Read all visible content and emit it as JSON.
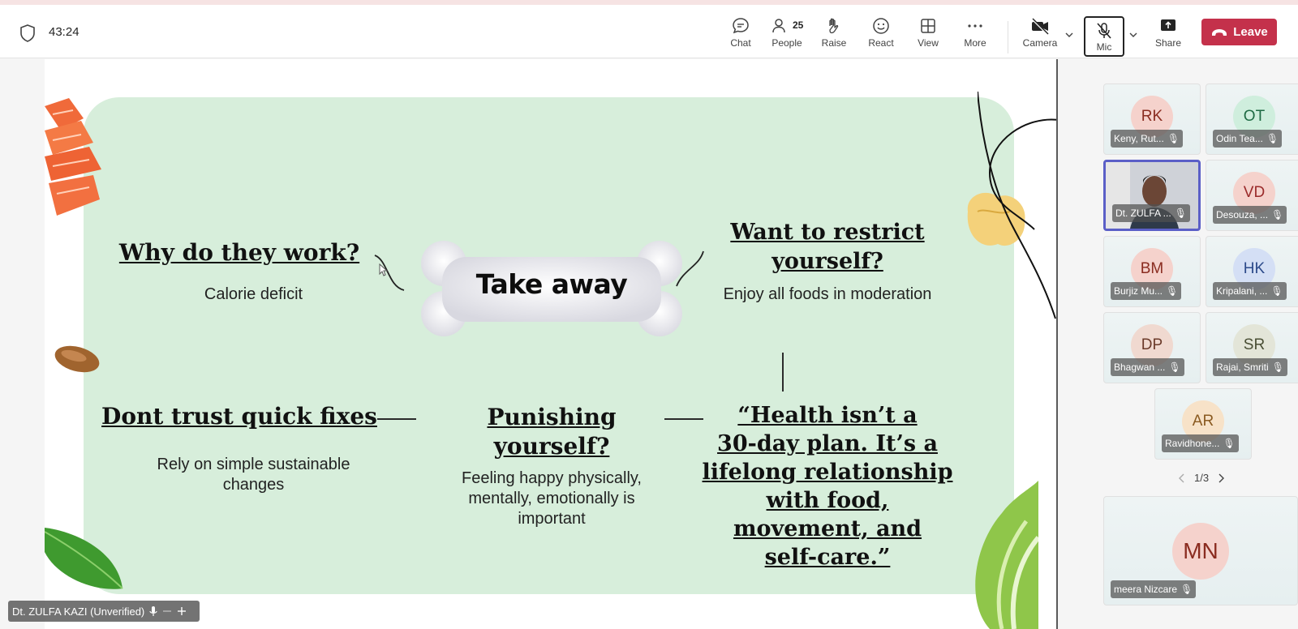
{
  "meeting": {
    "timer": "43:24"
  },
  "toolbar": {
    "chat": "Chat",
    "people": "People",
    "people_count": "25",
    "raise": "Raise",
    "react": "React",
    "view": "View",
    "more": "More",
    "camera": "Camera",
    "mic": "Mic",
    "share": "Share",
    "leave": "Leave"
  },
  "slide": {
    "center_label": "Take away",
    "why_title": "Why do they work?",
    "why_text": "Calorie deficit",
    "restrict_title_1": "Want to restrict",
    "restrict_title_2": "yourself?",
    "restrict_text": "Enjoy all foods in moderation",
    "fixes_title": "Dont trust quick fixes",
    "fixes_text_1": "Rely on simple sustainable",
    "fixes_text_2": "changes",
    "punish_title_1": "Punishing",
    "punish_title_2": "yourself?",
    "punish_text_1": "Feeling happy physically,",
    "punish_text_2": "mentally, emotionally is",
    "punish_text_3": "important",
    "quote_1": "“Health isn’t a",
    "quote_2": "30-day plan. It’s a",
    "quote_3": "lifelong relationship",
    "quote_4": "with food,",
    "quote_5": "movement, and",
    "quote_6": "self-care.”"
  },
  "presenter": {
    "label": "Dt. ZULFA KAZI (Unverified)"
  },
  "participants": [
    {
      "initials": "RK",
      "name": "Keny, Rut...",
      "bg": "#f5d2cc",
      "fg": "#8a2c20"
    },
    {
      "initials": "OT",
      "name": "Odin Tea...",
      "bg": "#cfeedd",
      "fg": "#1f6b44"
    },
    {
      "initials": "",
      "name": "Dt. ZULFA ...",
      "bg": "#4a4a52",
      "fg": "#ffffff"
    },
    {
      "initials": "VD",
      "name": "Desouza, ...",
      "bg": "#f5d2cc",
      "fg": "#9b2b2b"
    },
    {
      "initials": "BM",
      "name": "Burjiz Mu...",
      "bg": "#f5d2cc",
      "fg": "#8a2c20"
    },
    {
      "initials": "HK",
      "name": "Kripalani, ...",
      "bg": "#d4dff5",
      "fg": "#2c4a8a"
    },
    {
      "initials": "DP",
      "name": "Bhagwan ...",
      "bg": "#f0d9d0",
      "fg": "#6b3a2a"
    },
    {
      "initials": "SR",
      "name": "Rajai, Smriti",
      "bg": "#e3e5d8",
      "fg": "#4a4f35"
    },
    {
      "initials": "AR",
      "name": "Ravidhone...",
      "bg": "#f7e2c8",
      "fg": "#8a5a20"
    }
  ],
  "pager": {
    "label": "1/3"
  },
  "featured": {
    "initials": "MN",
    "name": "meera Nizcare",
    "bg": "#f5d2cc",
    "fg": "#8a2c20"
  }
}
